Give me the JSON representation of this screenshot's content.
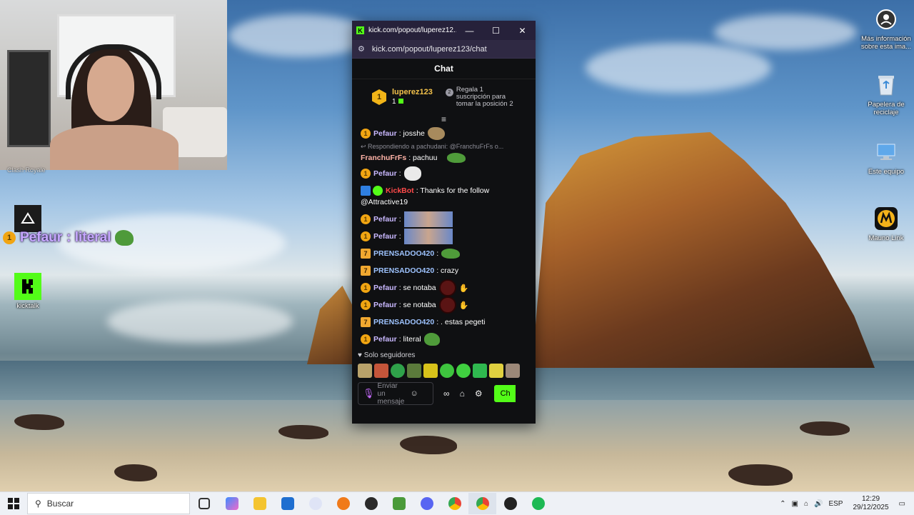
{
  "webcam": {
    "caption": "Clash Royale"
  },
  "overlay": {
    "badge": "1",
    "user": "Pefaur",
    "text": ": literal"
  },
  "desktop_icons": {
    "info_line1": "Más información",
    "info_line2": "sobre esta ima...",
    "recycle_line1": "Papelera de",
    "recycle_line2": "reciclaje",
    "this_pc": "Este equipo",
    "macro": "Mauno Link",
    "kicktalk": "kicktalk"
  },
  "browser": {
    "title": "kick.com/popout/luperez12...",
    "url": "kick.com/popout/luperez123/chat",
    "min": "—",
    "max": "☐",
    "close": "✕"
  },
  "chat": {
    "header": "Chat",
    "pinned": {
      "rank": "1",
      "user": "luperez123",
      "count": "1",
      "gift_line1": "Regala 1",
      "gift_line2": "suscripción para",
      "gift_line3": "tomar la posición 2"
    },
    "collapse": "≡",
    "reply": "↩ Respondiendo a pachudani: @FranchuFrFs o...",
    "messages": {
      "m1": {
        "badge": "1",
        "user": "Pefaur",
        "text": ": josshe"
      },
      "m2": {
        "user": "FranchuFrFs",
        "text": ": pachuu"
      },
      "m3": {
        "badge": "1",
        "user": "Pefaur",
        "text": ":"
      },
      "m4": {
        "user": "KickBot",
        "text": ": Thanks for the follow",
        "text2": "@Attractive19"
      },
      "m5": {
        "badge": "1",
        "user": "Pefaur",
        "text": ":"
      },
      "m6": {
        "badge": "1",
        "user": "Pefaur",
        "text": ":"
      },
      "m7": {
        "badge": "7",
        "user": "PRENSADOO420",
        "text": ":"
      },
      "m8": {
        "badge": "7",
        "user": "PRENSADOO420",
        "text": ": crazy"
      },
      "m9": {
        "badge": "1",
        "user": "Pefaur",
        "text": ": se notaba"
      },
      "m10": {
        "badge": "1",
        "user": "Pefaur",
        "text": ": se notaba"
      },
      "m11": {
        "badge": "7",
        "user": "PRENSADOO420",
        "text": ": . estas pegeti"
      },
      "m12": {
        "badge": "1",
        "user": "Pefaur",
        "text": ": literal"
      }
    },
    "followers_only": "Solo seguidores",
    "input_placeholder": "Enviar un mensaje",
    "send_label": "Ch"
  },
  "taskbar": {
    "search_placeholder": "Buscar",
    "lang": "ESP",
    "time": "12:29",
    "date": "29/12/2025"
  },
  "colors": {
    "kick_green": "#53fc18",
    "accent_gold": "#f1a512"
  }
}
